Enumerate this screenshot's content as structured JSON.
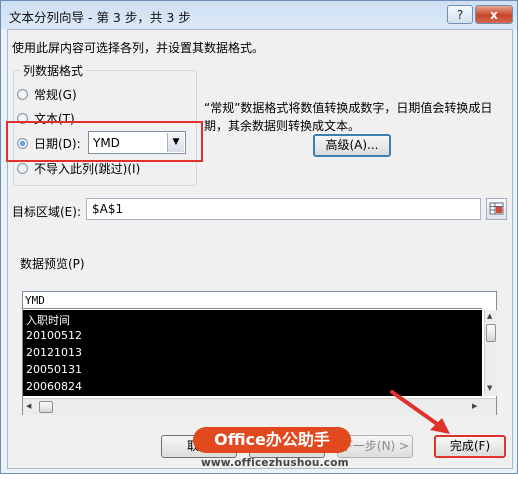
{
  "window": {
    "title": "文本分列向导 - 第 3 步，共 3 步",
    "help_label": "?",
    "close_label": "x"
  },
  "description": "使用此屏内容可选择各列，并设置其数据格式。",
  "column_format": {
    "title": "列数据格式",
    "options": [
      {
        "label": "常规(G)",
        "selected": false
      },
      {
        "label": "文本(T)",
        "selected": false
      },
      {
        "label": "日期(D):",
        "selected": true
      },
      {
        "label": "不导入此列(跳过)(I)",
        "selected": false
      }
    ],
    "date_format_value": "YMD"
  },
  "note": "“常规”数据格式将数值转换成数字，日期值会转换成日期，其余数据则转换成文本。",
  "advanced_button": "高级(A)...",
  "destination": {
    "label": "目标区域(E):",
    "value": "$A$1"
  },
  "preview": {
    "label": "数据预览(P)",
    "header": "YMD",
    "rows": [
      "入职时间",
      "20100512",
      "20121013",
      "20050131",
      "20060824"
    ]
  },
  "buttons": {
    "cancel": "取消",
    "back": "< 上一步(B)",
    "next": "下一步(N) >",
    "finish": "完成(F)"
  },
  "watermark": {
    "badge": "Office办公助手",
    "url": "www.officezhushou.com"
  },
  "colors": {
    "highlight": "#e0322c",
    "accent": "#3c7fb1",
    "preview_background": "#000000"
  }
}
